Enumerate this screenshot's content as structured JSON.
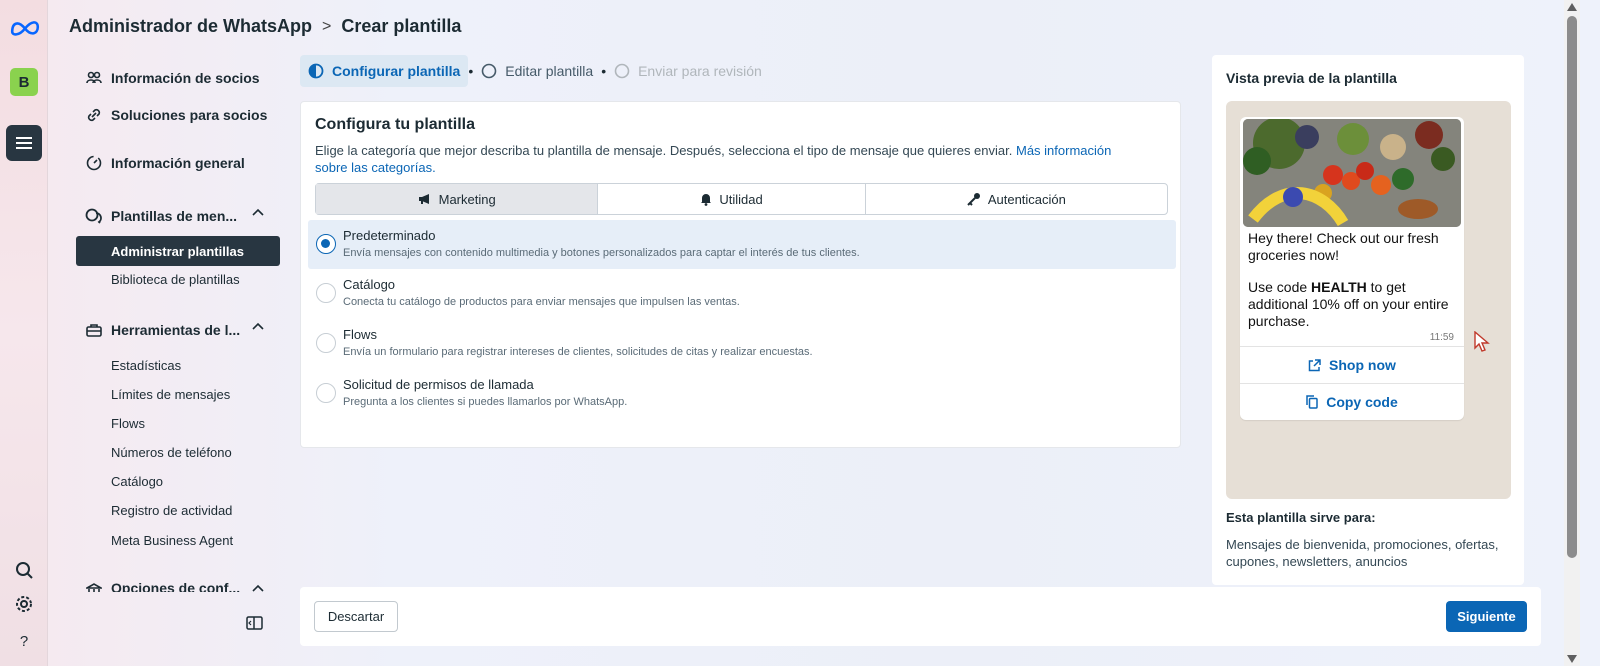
{
  "header": {
    "app_title": "Administrador de WhatsApp",
    "separator": ">",
    "page_title": "Crear plantilla"
  },
  "rail": {
    "business_initial": "B",
    "help_label": "?"
  },
  "sidebar": {
    "items": [
      {
        "label": "Información de socios",
        "icon": "partners-icon"
      },
      {
        "label": "Soluciones para socios",
        "icon": "link-icon"
      },
      {
        "label": "Información general",
        "icon": "overview-icon"
      },
      {
        "label": "Plantillas de men...",
        "icon": "templates-icon"
      },
      {
        "label": "Herramientas de l...",
        "icon": "toolbox-icon"
      },
      {
        "label": "Opciones de conf...",
        "icon": "settings-bank-icon"
      }
    ],
    "templates_sub": [
      "Administrar plantillas",
      "Biblioteca de plantillas"
    ],
    "tools_sub": [
      "Estadísticas",
      "Límites de mensajes",
      "Flows",
      "Números de teléfono",
      "Catálogo",
      "Registro de actividad",
      "Meta Business Agent"
    ]
  },
  "stepper": {
    "steps": [
      "Configurar plantilla",
      "Editar plantilla",
      "Enviar para revisión"
    ],
    "active_index": 0
  },
  "config": {
    "title": "Configura tu plantilla",
    "description": "Elige la categoría que mejor describa tu plantilla de mensaje. Después, selecciona el tipo de mensaje que quieres enviar.",
    "link_text": "Más información sobre las categorías.",
    "categories": [
      "Marketing",
      "Utilidad",
      "Autenticación"
    ],
    "selected_category": "Marketing",
    "options": [
      {
        "title": "Predeterminado",
        "desc": "Envía mensajes con contenido multimedia y botones personalizados para captar el interés de tus clientes.",
        "selected": true
      },
      {
        "title": "Catálogo",
        "desc": "Conecta tu catálogo de productos para enviar mensajes que impulsen las ventas.",
        "selected": false
      },
      {
        "title": "Flows",
        "desc": "Envía un formulario para registrar intereses de clientes, solicitudes de citas y realizar encuestas.",
        "selected": false
      },
      {
        "title": "Solicitud de permisos de llamada",
        "desc": "Pregunta a los clientes si puedes llamarlos por WhatsApp.",
        "selected": false
      }
    ]
  },
  "preview": {
    "title": "Vista previa de la plantilla",
    "message_line1": "Hey there! Check out our fresh groceries now!",
    "message_pre": "Use code ",
    "message_code": "HEALTH",
    "message_post": " to get additional 10% off on your entire purchase.",
    "time": "11:59",
    "button1": "Shop now",
    "button2": "Copy code",
    "use_title": "Esta plantilla sirve para:",
    "use_text": "Mensajes de bienvenida, promociones, ofertas, cupones, newsletters, anuncios"
  },
  "footer": {
    "discard_label": "Descartar",
    "next_label": "Siguiente"
  },
  "colors": {
    "accent": "#0b66b5",
    "sidebar_active": "#283641",
    "badge": "#8ad24e"
  }
}
